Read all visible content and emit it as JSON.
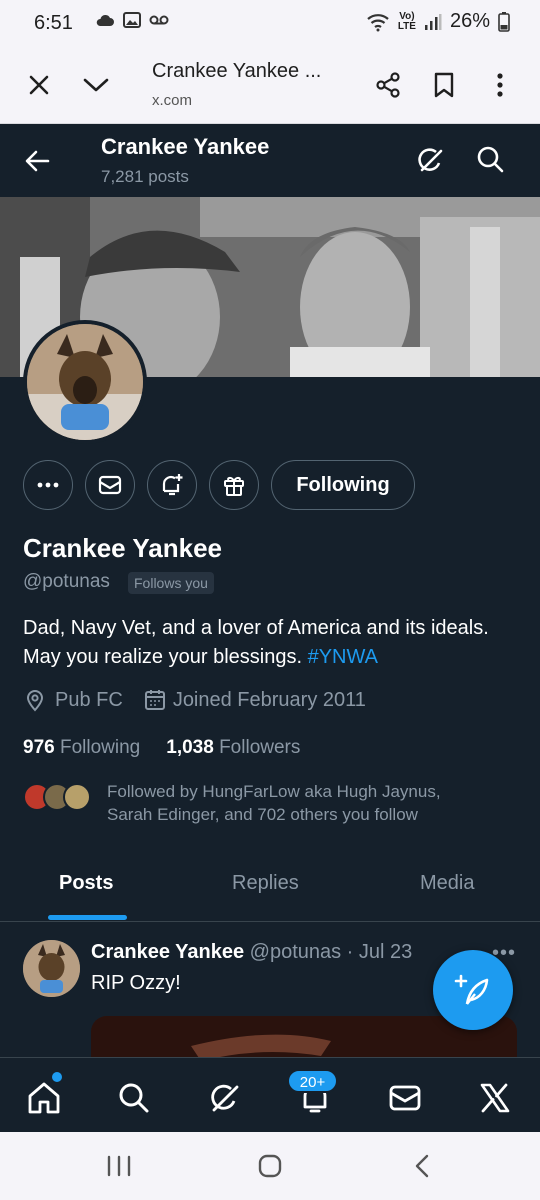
{
  "status_bar": {
    "time": "6:51",
    "lte_top": "Vo)",
    "lte_bottom": "LTE",
    "battery": "26%"
  },
  "browser": {
    "title": "Crankee Yankee ...",
    "url": "x.com"
  },
  "header": {
    "name": "Crankee Yankee",
    "post_count": "7,281 posts"
  },
  "profile": {
    "following_button": "Following",
    "display_name": "Crankee Yankee",
    "handle": "@potunas",
    "follows_you": "Follows you",
    "bio_text": "Dad, Navy Vet, and a lover of America and its ideals. May you realize your blessings. ",
    "bio_hashtag": "#YNWA",
    "location": "Pub FC",
    "joined": "Joined February 2011",
    "following_count": "976",
    "following_label": "Following",
    "followers_count": "1,038",
    "followers_label": "Followers",
    "followed_by_line1": "Followed by HungFarLow aka Hugh Jaynus,",
    "followed_by_line2": "Sarah Edinger, and 702 others you follow"
  },
  "tabs": [
    "Posts",
    "Replies",
    "Media"
  ],
  "post": {
    "author": "Crankee Yankee",
    "meta": "@potunas · Jul 23",
    "text": "RIP Ozzy!"
  },
  "bottom_nav": {
    "notifications_badge": "20+"
  },
  "colors": {
    "background": "#15202b",
    "accent": "#1d9bf0",
    "muted_text": "#8b98a5",
    "border": "#536471"
  }
}
